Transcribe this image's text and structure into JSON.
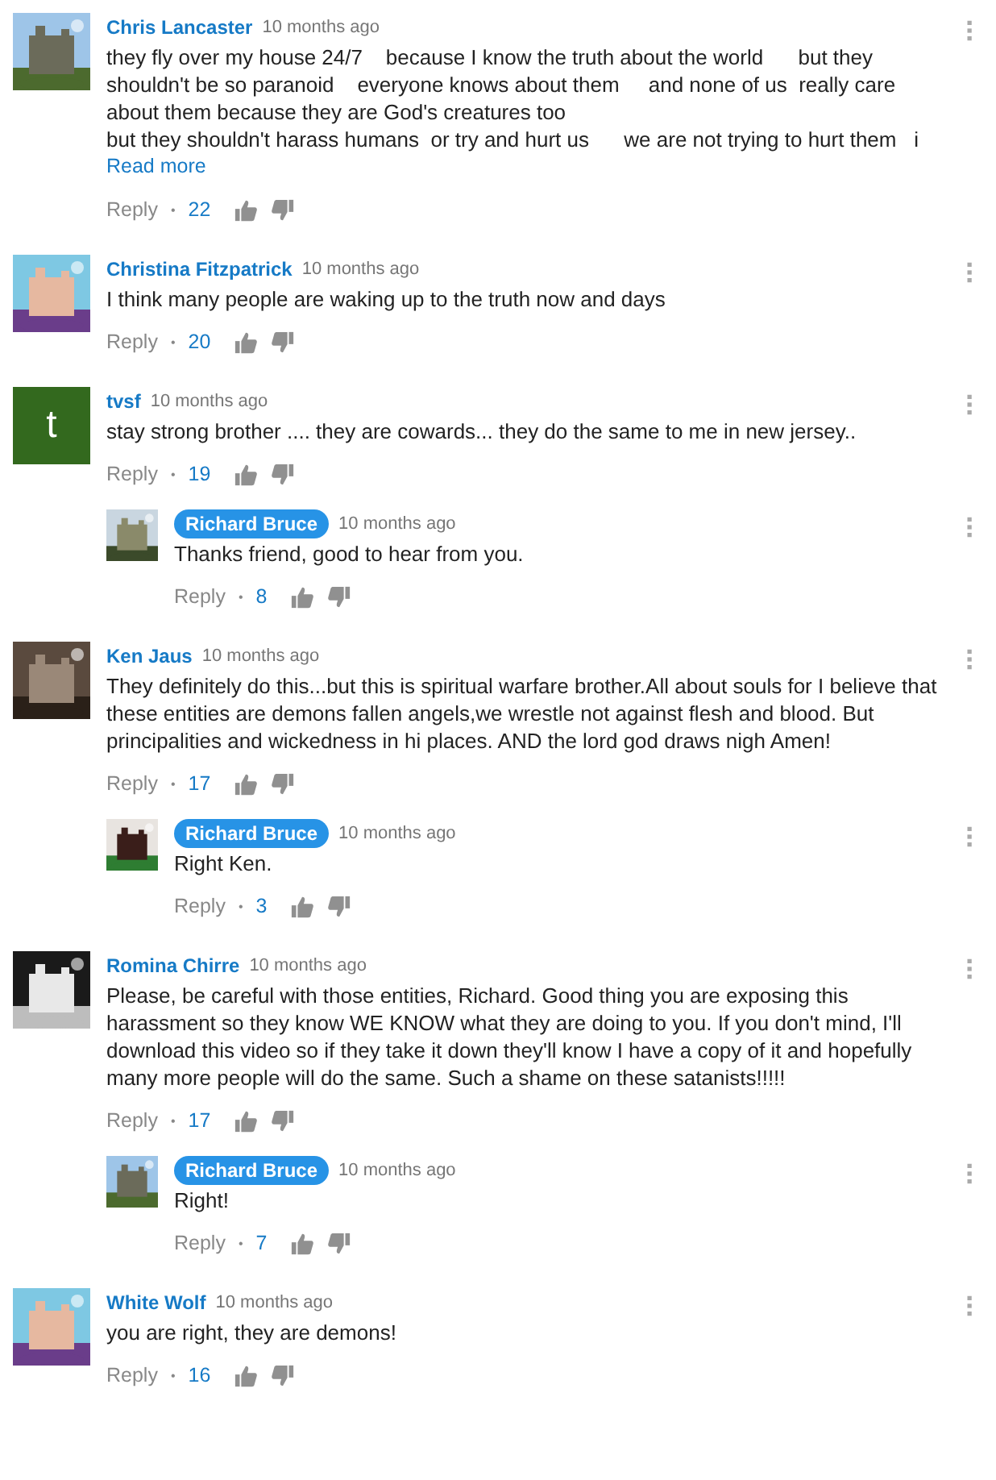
{
  "comments": [
    {
      "author": "Chris Lancaster",
      "owner": false,
      "time": "10 months ago",
      "text": "they fly over my house 24/7    because I know the truth about the world      but they shouldn't be so paranoid    everyone knows about them     and none of us  really care about them because they are God's creatures too\nbut they shouldn't harass humans  or try and hurt us      we are not trying to hurt them   i",
      "read_more": "Read more",
      "reply": "Reply",
      "separator": "•",
      "likes": "22"
    },
    {
      "author": "Christina Fitzpatrick",
      "owner": false,
      "time": "10 months ago",
      "text": "I think many people are waking up to the truth now and days",
      "reply": "Reply",
      "separator": "•",
      "likes": "20"
    },
    {
      "author": "tvsf",
      "owner": false,
      "time": "10 months ago",
      "avatar": {
        "kind": "letter",
        "letter": "t",
        "color": "#33691e"
      },
      "text": "stay strong brother .... they are cowards... they do the same to me in new jersey..",
      "reply": "Reply",
      "separator": "•",
      "likes": "19",
      "replies": [
        {
          "author": "Richard Bruce",
          "owner": true,
          "time": "10 months ago",
          "text": "Thanks friend, good to hear from you.",
          "reply": "Reply",
          "separator": "•",
          "likes": "8"
        }
      ]
    },
    {
      "author": "Ken Jaus",
      "owner": false,
      "time": "10 months ago",
      "text": "They definitely do this...but this is spiritual warfare brother.All about souls for I believe that these entities are demons fallen angels,we wrestle not against flesh and blood. But principalities and wickedness in hi places. AND the lord god draws nigh Amen!",
      "reply": "Reply",
      "separator": "•",
      "likes": "17",
      "replies": [
        {
          "author": "Richard Bruce",
          "owner": true,
          "time": "10 months ago",
          "text": "Right Ken.",
          "reply": "Reply",
          "separator": "•",
          "likes": "3"
        }
      ]
    },
    {
      "author": "Romina Chirre",
      "owner": false,
      "time": "10 months ago",
      "text": "Please, be careful with those entities, Richard. Good thing you are exposing this harassment so they know WE KNOW what they are doing to you. If you don't mind, I'll download this video so if they take it down they'll know I have a copy of it and hopefully many more people will do the same. Such a shame on these satanists!!!!!",
      "reply": "Reply",
      "separator": "•",
      "likes": "17",
      "replies": [
        {
          "author": "Richard Bruce",
          "owner": true,
          "time": "10 months ago",
          "text": "Right!",
          "reply": "Reply",
          "separator": "•",
          "likes": "7"
        }
      ]
    },
    {
      "author": "White Wolf",
      "owner": false,
      "time": "10 months ago",
      "text": "you are right, they are demons!",
      "reply": "Reply",
      "separator": "•",
      "likes": "16"
    }
  ]
}
